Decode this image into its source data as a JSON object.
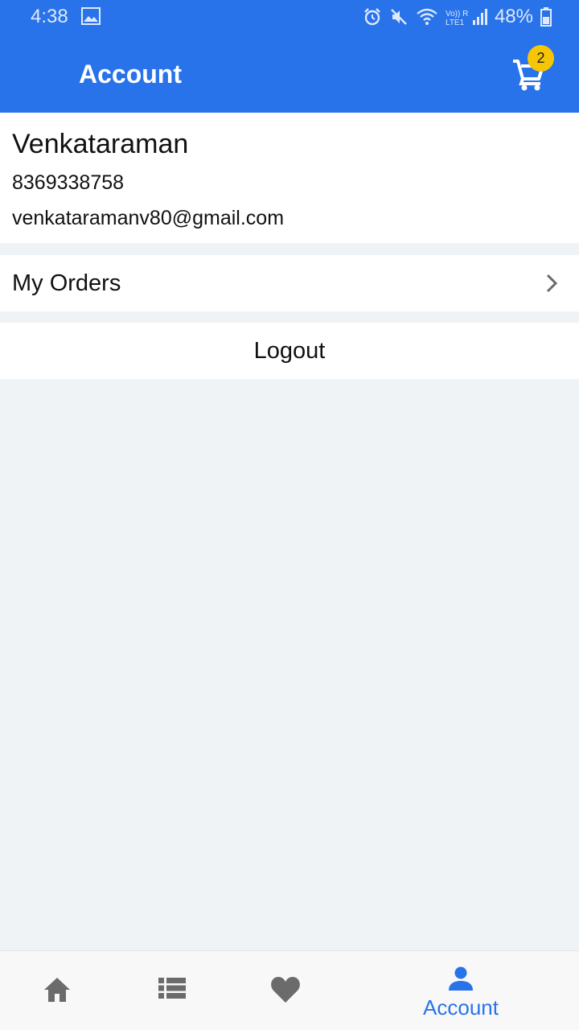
{
  "status_bar": {
    "time": "4:38",
    "battery": "48%",
    "network_label": "Vo)) R LTE1"
  },
  "header": {
    "title": "Account",
    "cart_count": "2"
  },
  "profile": {
    "name": "Venkataraman",
    "phone": "8369338758",
    "email": "venkataramanv80@gmail.com"
  },
  "menu": {
    "orders_label": "My Orders",
    "logout_label": "Logout"
  },
  "bottom_nav": {
    "items": [
      {
        "icon": "home-icon",
        "label": ""
      },
      {
        "icon": "list-icon",
        "label": ""
      },
      {
        "icon": "heart-icon",
        "label": ""
      },
      {
        "icon": "person-icon",
        "label": "Account",
        "active": true
      }
    ]
  },
  "colors": {
    "primary": "#2873ea",
    "badge": "#f6c506",
    "background": "#eff3f6",
    "inactive_icon": "#6b6b6b"
  }
}
